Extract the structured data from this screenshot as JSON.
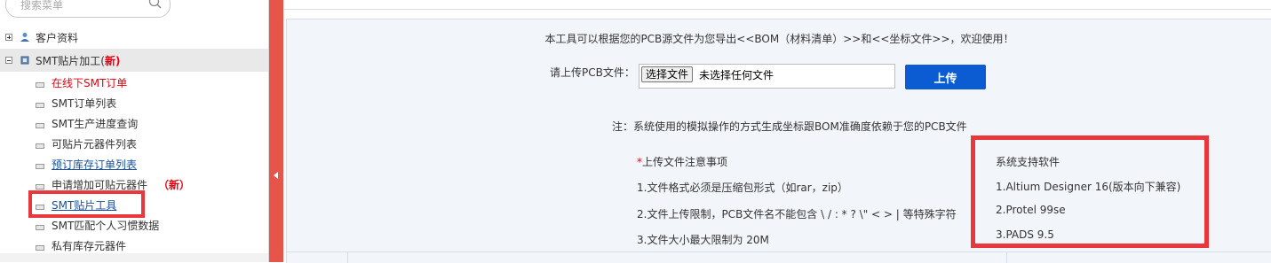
{
  "search": {
    "placeholder": "搜索菜单"
  },
  "sidebar": {
    "groups": [
      {
        "label": "客户资料"
      },
      {
        "label": "SMT贴片加工(",
        "new_label": "新)"
      }
    ],
    "items": [
      {
        "label": "在线下SMT订单",
        "style": "red"
      },
      {
        "label": "SMT订单列表"
      },
      {
        "label": "SMT生产进度查询"
      },
      {
        "label": "可贴片元器件列表"
      },
      {
        "label": "预订库存订单列表",
        "style": "link"
      },
      {
        "label": "申请增加可贴元器件",
        "tag": "（新）"
      },
      {
        "label": "SMT贴片工具",
        "style": "link"
      },
      {
        "label": "SMT匹配个人习惯数据"
      },
      {
        "label": "私有库存元器件"
      }
    ]
  },
  "main": {
    "intro": "本工具可以根据您的PCB源文件为您导出<<BOM（材料清单）>>和<<坐标文件>>，欢迎使用！",
    "upload_label": "请上传PCB文件：",
    "choose_file": "选择文件",
    "no_file": "未选择任何文件",
    "upload_button": "上传",
    "note": "注：系统使用的模拟操作的方式生成坐标跟BOM准确度依赖于您的PCB文件",
    "requirements": {
      "star": "*",
      "title": "上传文件注意事项",
      "items": [
        "1.文件格式必须是压缩包形式（如rar，zip）",
        "2.文件上传限制，PCB文件名不能包含 \\ / : * ? \\\" < > | 等特殊字符",
        "3.文件大小最大限制为 20M"
      ]
    },
    "support": {
      "title": "系统支持软件",
      "items": [
        "1.Altium Designer 16(版本向下兼容)",
        "2.Protel 99se",
        "3.PADS 9.5"
      ]
    }
  },
  "colors": {
    "accent_red": "#e8383d",
    "upload_blue": "#0b5bd3",
    "panel_bg": "#f2f6fb",
    "new_red": "#e60012"
  }
}
